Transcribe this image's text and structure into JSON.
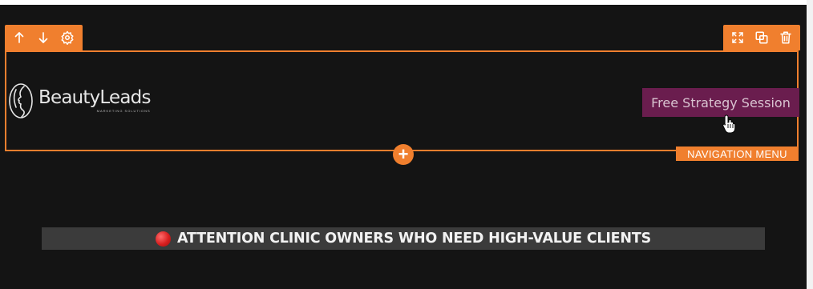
{
  "header": {
    "logo": {
      "name": "BeautyLeads",
      "tagline": "MARKETING SOLUTIONS"
    },
    "cta_button": "Free Strategy Session"
  },
  "section_label": "NAVIGATION MENU",
  "banner": {
    "icon": "red-circle-icon",
    "text": "ATTENTION CLINIC OWNERS WHO NEED HIGH-VALUE CLIENTS"
  },
  "toolbar_left": [
    "arrow-up-icon",
    "arrow-down-icon",
    "gear-icon"
  ],
  "toolbar_right": [
    "expand-icon",
    "duplicate-icon",
    "trash-icon"
  ],
  "colors": {
    "accent": "#f07f2e",
    "cta_bg": "#6a1d4e",
    "canvas_bg": "#141414",
    "banner_bg": "#3b3b3b"
  }
}
